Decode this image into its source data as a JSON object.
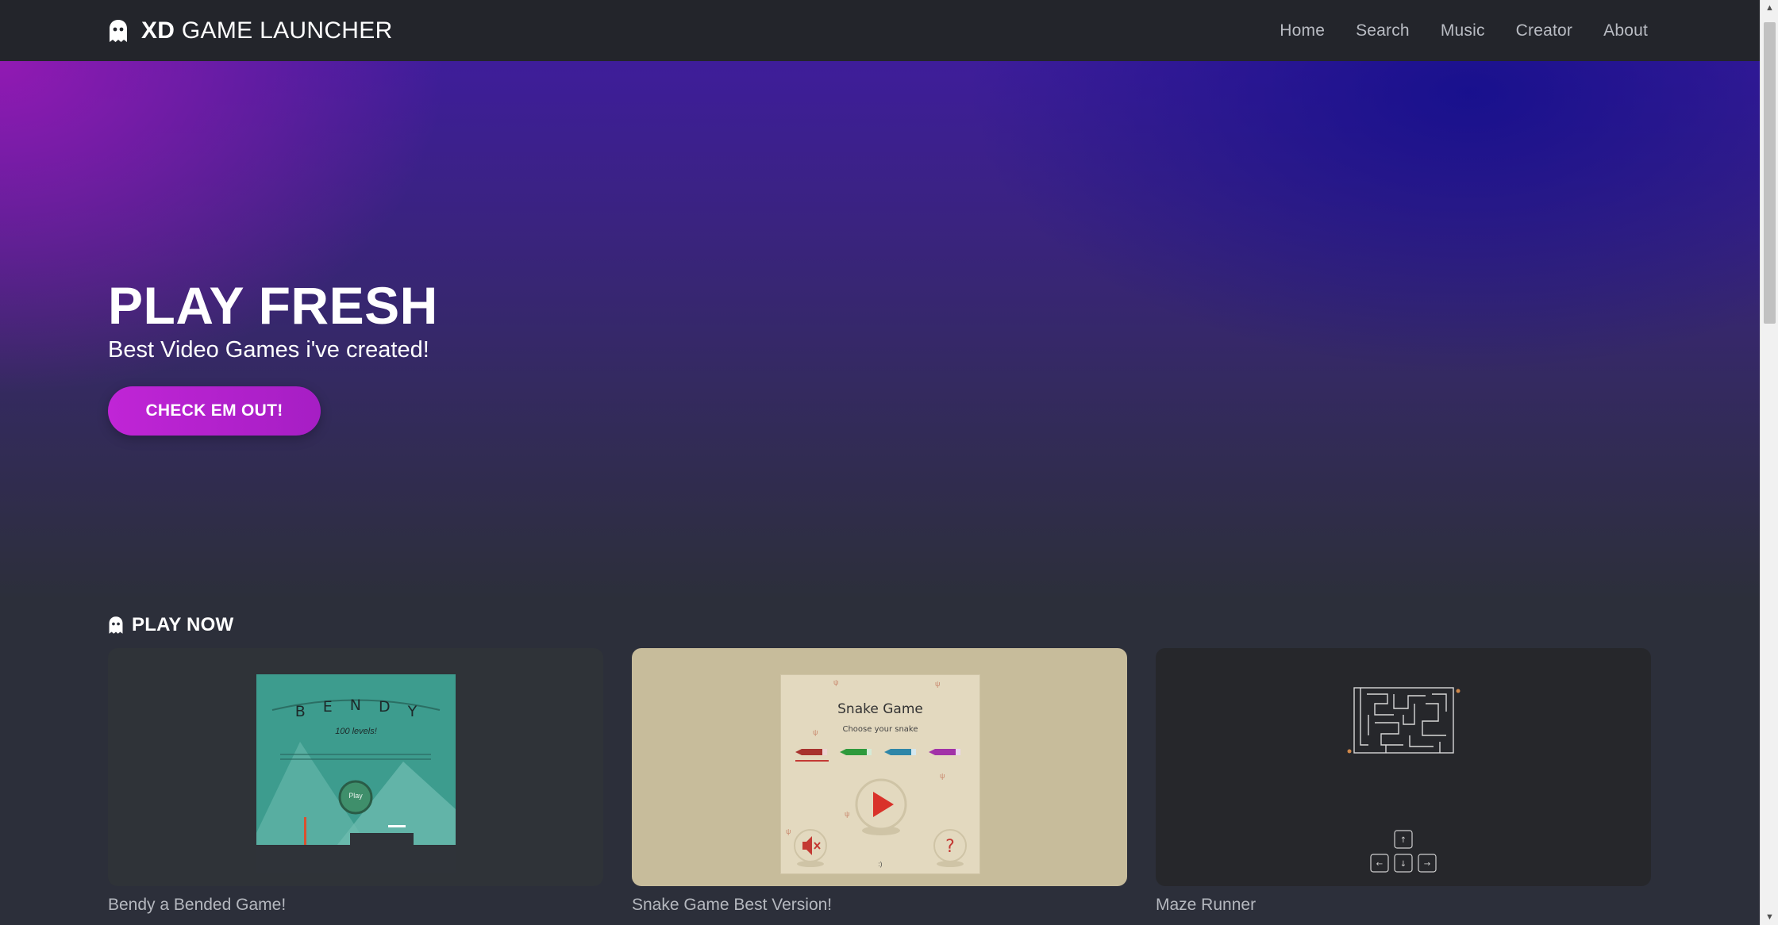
{
  "nav": {
    "brand_bold": "XD",
    "brand_rest": "GAME LAUNCHER",
    "brand_icon": "ghost-icon",
    "links": [
      "Home",
      "Search",
      "Music",
      "Creator",
      "About"
    ]
  },
  "hero": {
    "title": "PLAY FRESH",
    "subtitle": "Best Video Games i've created!",
    "cta_label": "CHECK EM OUT!"
  },
  "section": {
    "icon": "ghost-icon",
    "title": "PLAY NOW"
  },
  "games": [
    {
      "title": "Bendy a Bended Game!",
      "screen": {
        "logo_letters": [
          "B",
          "E",
          "N",
          "D",
          "Y"
        ],
        "levels": "100 levels!",
        "play": "Play"
      }
    },
    {
      "title": "Snake Game Best Version!",
      "screen": {
        "heading": "Snake Game",
        "prompt": "Choose your snake",
        "footer": ":)"
      }
    },
    {
      "title": "Maze Runner"
    }
  ],
  "colors": {
    "nav_bg": "#23252b",
    "page_bg": "#2c2f3a",
    "cta_gradient_start": "#c025d6",
    "cta_gradient_end": "#a61ec4",
    "snake_colors": [
      "#a8322e",
      "#2e9a3c",
      "#2e86a8",
      "#a232a8"
    ]
  }
}
